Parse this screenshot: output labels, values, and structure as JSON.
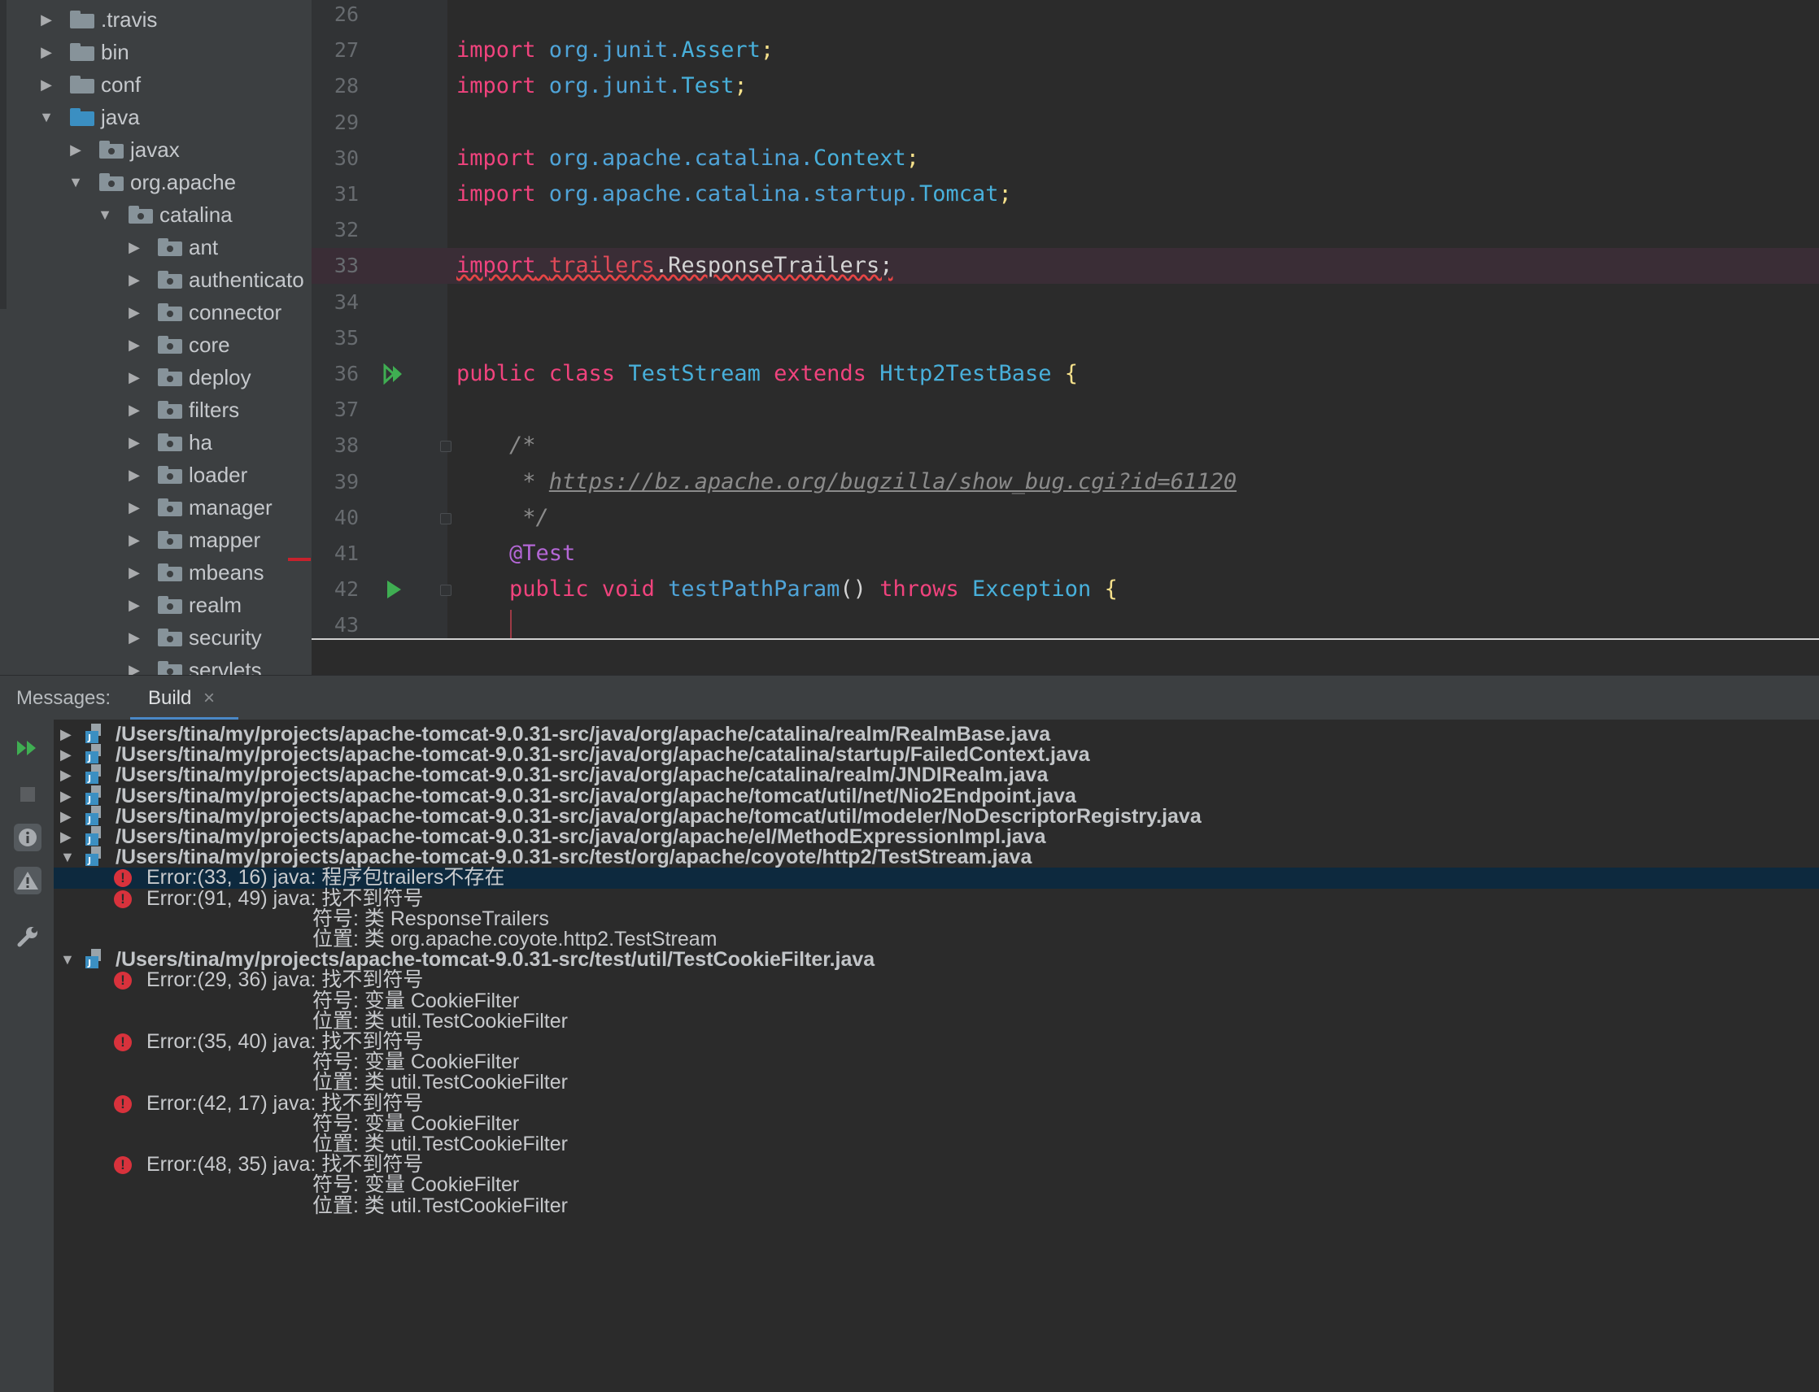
{
  "project_tree": {
    "items": [
      {
        "label": ".travis",
        "expanded": false,
        "depth": 0
      },
      {
        "label": "bin",
        "expanded": false,
        "depth": 0
      },
      {
        "label": "conf",
        "expanded": false,
        "depth": 0
      },
      {
        "label": "java",
        "expanded": true,
        "depth": 0
      },
      {
        "label": "javax",
        "expanded": false,
        "depth": 1
      },
      {
        "label": "org.apache",
        "expanded": true,
        "depth": 1
      },
      {
        "label": "catalina",
        "expanded": true,
        "depth": 2
      },
      {
        "label": "ant",
        "expanded": false,
        "depth": 3
      },
      {
        "label": "authenticato",
        "expanded": false,
        "depth": 3
      },
      {
        "label": "connector",
        "expanded": false,
        "depth": 3
      },
      {
        "label": "core",
        "expanded": false,
        "depth": 3
      },
      {
        "label": "deploy",
        "expanded": false,
        "depth": 3
      },
      {
        "label": "filters",
        "expanded": false,
        "depth": 3
      },
      {
        "label": "ha",
        "expanded": false,
        "depth": 3
      },
      {
        "label": "loader",
        "expanded": false,
        "depth": 3
      },
      {
        "label": "manager",
        "expanded": false,
        "depth": 3
      },
      {
        "label": "mapper",
        "expanded": false,
        "depth": 3
      },
      {
        "label": "mbeans",
        "expanded": false,
        "depth": 3
      },
      {
        "label": "realm",
        "expanded": false,
        "depth": 3
      },
      {
        "label": "security",
        "expanded": false,
        "depth": 3
      },
      {
        "label": "servlets",
        "expanded": false,
        "depth": 3
      }
    ]
  },
  "editor": {
    "lines": [
      {
        "num": "26",
        "tokens": []
      },
      {
        "num": "27",
        "tokens": [
          {
            "t": "import",
            "c": "kw"
          },
          {
            "t": " org.junit.",
            "c": "pk"
          },
          {
            "t": "Assert",
            "c": "cls"
          },
          {
            "t": ";",
            "c": "semi"
          }
        ]
      },
      {
        "num": "28",
        "tokens": [
          {
            "t": "import",
            "c": "kw"
          },
          {
            "t": " org.junit.",
            "c": "pk"
          },
          {
            "t": "Test",
            "c": "cls"
          },
          {
            "t": ";",
            "c": "semi"
          }
        ]
      },
      {
        "num": "29",
        "tokens": []
      },
      {
        "num": "30",
        "tokens": [
          {
            "t": "import",
            "c": "kw"
          },
          {
            "t": " org.apache.catalina.",
            "c": "pk"
          },
          {
            "t": "Context",
            "c": "cls"
          },
          {
            "t": ";",
            "c": "semi"
          }
        ]
      },
      {
        "num": "31",
        "tokens": [
          {
            "t": "import",
            "c": "kw"
          },
          {
            "t": " org.apache.catalina.startup.",
            "c": "pk"
          },
          {
            "t": "Tomcat",
            "c": "cls"
          },
          {
            "t": ";",
            "c": "semi"
          }
        ]
      },
      {
        "num": "32",
        "tokens": []
      },
      {
        "num": "33",
        "highlight": true,
        "tokens": [
          {
            "t": "import",
            "c": "kw err"
          },
          {
            "t": " ",
            "c": "plain err"
          },
          {
            "t": "trailers",
            "c": "errred"
          },
          {
            "t": ".ResponseTrailers;",
            "c": "plain err"
          }
        ]
      },
      {
        "num": "34",
        "tokens": []
      },
      {
        "num": "35",
        "tokens": []
      },
      {
        "num": "36",
        "gutter_icon": "run-all",
        "tokens": [
          {
            "t": "public class ",
            "c": "kw"
          },
          {
            "t": "TestStream",
            "c": "cls"
          },
          {
            "t": " extends ",
            "c": "kw"
          },
          {
            "t": "Http2TestBase",
            "c": "cls"
          },
          {
            "t": " {",
            "c": "brace"
          }
        ]
      },
      {
        "num": "37",
        "tokens": []
      },
      {
        "num": "38",
        "fold": true,
        "tokens": [
          {
            "t": "    /*",
            "c": "cm"
          }
        ]
      },
      {
        "num": "39",
        "tokens": [
          {
            "t": "     * ",
            "c": "cm"
          },
          {
            "t": "https://bz.apache.org/bugzilla/show_bug.cgi?id=61120",
            "c": "url"
          }
        ]
      },
      {
        "num": "40",
        "fold": true,
        "tokens": [
          {
            "t": "     */",
            "c": "cm"
          }
        ]
      },
      {
        "num": "41",
        "tokens": [
          {
            "t": "    @Test",
            "c": "ann"
          }
        ]
      },
      {
        "num": "42",
        "gutter_icon": "run",
        "fold": true,
        "tokens": [
          {
            "t": "    public void ",
            "c": "kw"
          },
          {
            "t": "testPathParam",
            "c": "method"
          },
          {
            "t": "() ",
            "c": "plain"
          },
          {
            "t": "throws ",
            "c": "kw"
          },
          {
            "t": "Exception",
            "c": "cls"
          },
          {
            "t": " {",
            "c": "brace"
          }
        ]
      },
      {
        "num": "43",
        "tokens": []
      }
    ]
  },
  "tool_window": {
    "messages_label": "Messages:",
    "build_tab_label": "Build",
    "close_symbol": "×"
  },
  "messages": {
    "rows": [
      {
        "type": "file",
        "expanded": false,
        "text": "/Users/tina/my/projects/apache-tomcat-9.0.31-src/java/org/apache/catalina/realm/RealmBase.java"
      },
      {
        "type": "file",
        "expanded": false,
        "text": "/Users/tina/my/projects/apache-tomcat-9.0.31-src/java/org/apache/catalina/startup/FailedContext.java"
      },
      {
        "type": "file",
        "expanded": false,
        "text": "/Users/tina/my/projects/apache-tomcat-9.0.31-src/java/org/apache/catalina/realm/JNDIRealm.java"
      },
      {
        "type": "file",
        "expanded": false,
        "text": "/Users/tina/my/projects/apache-tomcat-9.0.31-src/java/org/apache/tomcat/util/net/Nio2Endpoint.java"
      },
      {
        "type": "file",
        "expanded": false,
        "text": "/Users/tina/my/projects/apache-tomcat-9.0.31-src/java/org/apache/tomcat/util/modeler/NoDescriptorRegistry.java"
      },
      {
        "type": "file",
        "expanded": false,
        "text": "/Users/tina/my/projects/apache-tomcat-9.0.31-src/java/org/apache/el/MethodExpressionImpl.java"
      },
      {
        "type": "file",
        "expanded": true,
        "text": "/Users/tina/my/projects/apache-tomcat-9.0.31-src/test/org/apache/coyote/http2/TestStream.java"
      },
      {
        "type": "error",
        "selected": true,
        "text": "Error:(33, 16)  java: 程序包trailers不存在"
      },
      {
        "type": "error",
        "text": "Error:(91, 49)  java: 找不到符号"
      },
      {
        "type": "detail",
        "text": "符号:   类 ResponseTrailers"
      },
      {
        "type": "detail",
        "text": "位置: 类 org.apache.coyote.http2.TestStream"
      },
      {
        "type": "file",
        "expanded": true,
        "text": "/Users/tina/my/projects/apache-tomcat-9.0.31-src/test/util/TestCookieFilter.java"
      },
      {
        "type": "error",
        "text": "Error:(29, 36)  java: 找不到符号"
      },
      {
        "type": "detail",
        "text": "符号:   变量 CookieFilter"
      },
      {
        "type": "detail",
        "text": "位置: 类 util.TestCookieFilter"
      },
      {
        "type": "error",
        "text": "Error:(35, 40)  java: 找不到符号"
      },
      {
        "type": "detail",
        "text": "符号:   变量 CookieFilter"
      },
      {
        "type": "detail",
        "text": "位置: 类 util.TestCookieFilter"
      },
      {
        "type": "error",
        "text": "Error:(42, 17)  java: 找不到符号"
      },
      {
        "type": "detail",
        "text": "符号:   变量 CookieFilter"
      },
      {
        "type": "detail",
        "text": "位置: 类 util.TestCookieFilter"
      },
      {
        "type": "error",
        "text": "Error:(48, 35)  java: 找不到符号"
      },
      {
        "type": "detail",
        "text": "符号:   变量 CookieFilter"
      },
      {
        "type": "detail",
        "text": "位置: 类 util.TestCookieFilter"
      }
    ]
  },
  "side_toolbar": {
    "icons": [
      "rerun-icon",
      "stop-icon",
      "info-filter-icon",
      "warning-filter-icon",
      "settings-wrench-icon"
    ]
  }
}
